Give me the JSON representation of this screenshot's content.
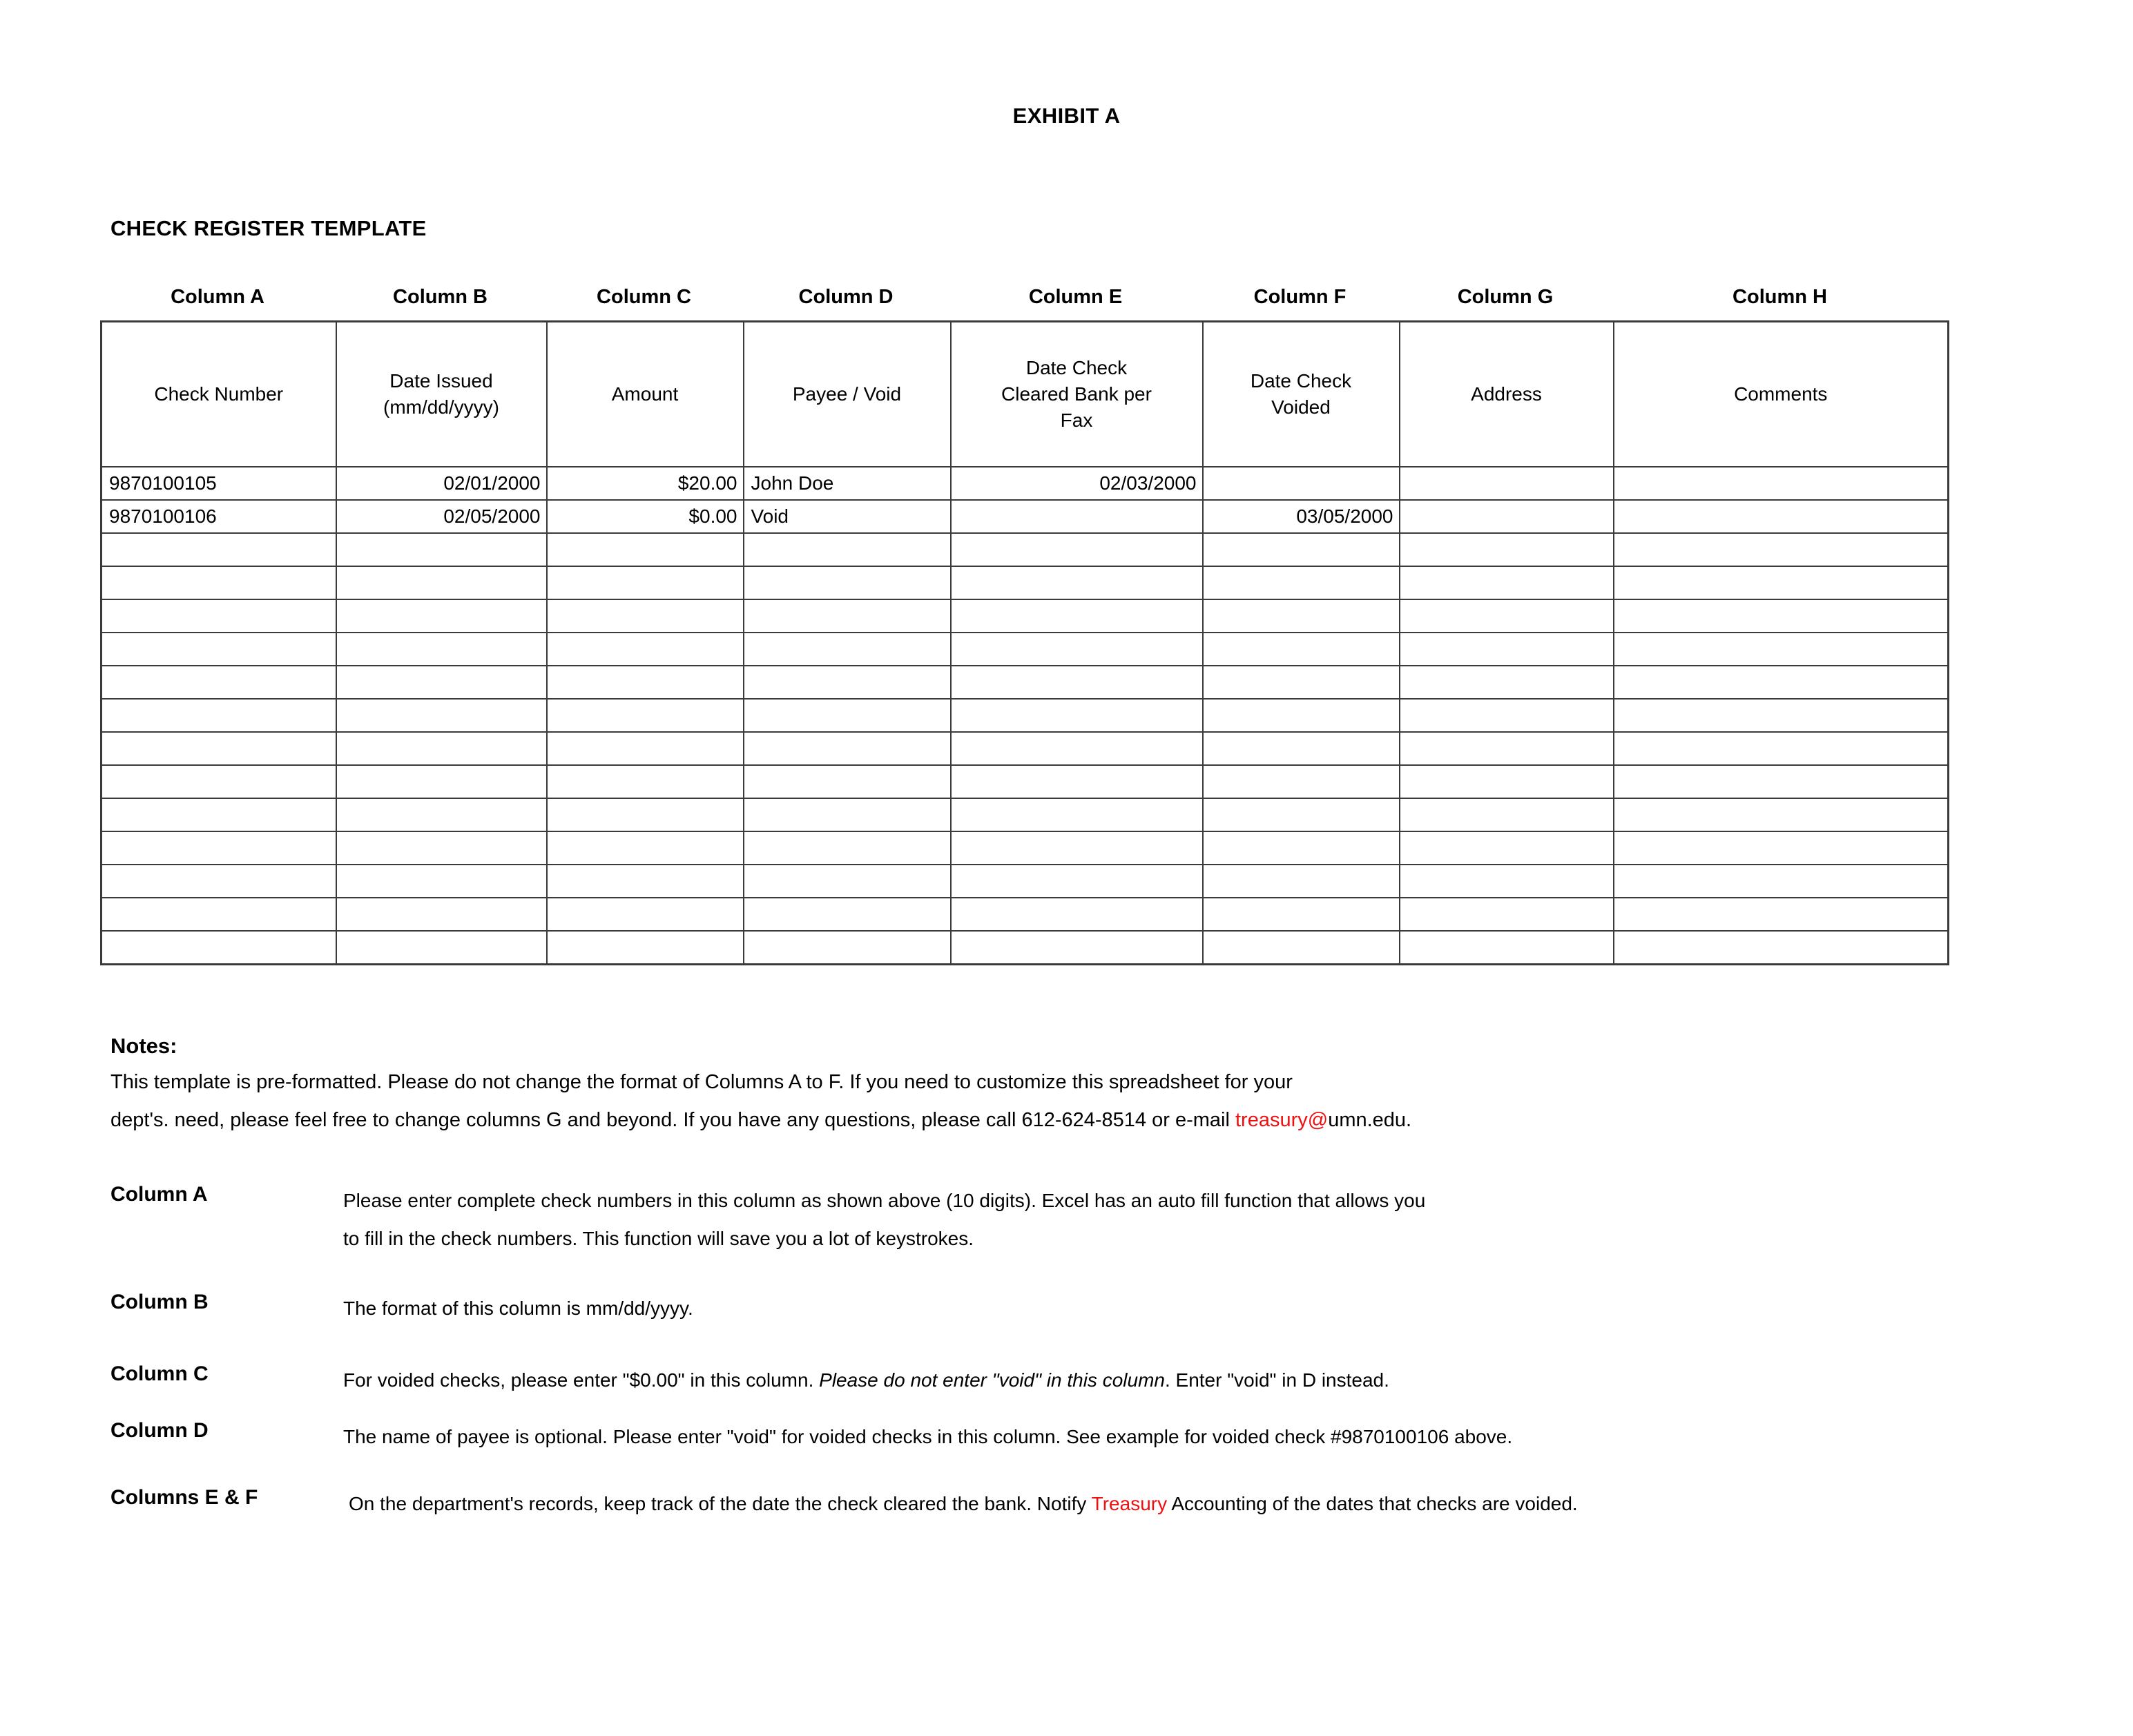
{
  "document": {
    "exhibit_title": "EXHIBIT A",
    "heading": "CHECK REGISTER TEMPLATE"
  },
  "table": {
    "column_letters": [
      "Column A",
      "Column B",
      "Column C",
      "Column D",
      "Column E",
      "Column F",
      "Column G",
      "Column H"
    ],
    "headers": [
      "Check Number",
      "Date Issued\n(mm/dd/yyyy)",
      "Amount",
      "Payee / Void",
      "Date Check\nCleared Bank per\nFax",
      "Date Check\nVoided",
      "Address",
      "Comments"
    ],
    "header_lines": {
      "a": [
        "Check Number"
      ],
      "b": [
        "Date Issued",
        "(mm/dd/yyyy)"
      ],
      "c": [
        "Amount"
      ],
      "d": [
        "Payee / Void"
      ],
      "e": [
        "Date Check",
        "Cleared Bank per",
        "Fax"
      ],
      "f": [
        "Date Check",
        "Voided"
      ],
      "g": [
        "Address"
      ],
      "h": [
        "Comments"
      ]
    },
    "rows": [
      {
        "check_number": "9870100105",
        "date_issued": "02/01/2000",
        "amount": "$20.00",
        "payee": "John Doe",
        "date_cleared": "02/03/2000",
        "date_voided": "",
        "address": "",
        "comments": ""
      },
      {
        "check_number": "9870100106",
        "date_issued": "02/05/2000",
        "amount": "$0.00",
        "payee": "Void",
        "date_cleared": "",
        "date_voided": "03/05/2000",
        "address": "",
        "comments": ""
      }
    ],
    "blank_row_count": 13
  },
  "notes": {
    "title": "Notes:",
    "line1": "This template is pre-formatted.  Please do not change the format of Columns A to F.  If you need to customize this spreadsheet for your",
    "line2_part1": "dept's. need, please feel free to change columns G and beyond.  If you have any questions, please call 612-624-8514 or e-mail ",
    "line2_email_red": "treasury@",
    "line2_email_black": "umn.edu."
  },
  "descriptions": [
    {
      "label": "Column A",
      "lines": [
        "Please enter complete check numbers in this column as shown above (10 digits).  Excel has an auto fill function that allows you",
        "to fill in the check numbers.  This function will save you a lot of keystrokes."
      ]
    },
    {
      "label": "Column B",
      "lines": [
        "The format of this column is mm/dd/yyyy."
      ]
    },
    {
      "label": "Column C",
      "segments": [
        {
          "text": "For voided checks, please enter \"$0.00\" in this column.  ",
          "style": "normal"
        },
        {
          "text": "Please do not enter \"void\" in this column",
          "style": "italic"
        },
        {
          "text": ".  Enter \"void\" in D instead.",
          "style": "normal"
        }
      ]
    },
    {
      "label": "Column D",
      "lines": [
        "The name of payee is optional.  Please enter \"void\" for voided checks in this column.  See example for voided check #9870100106 above."
      ]
    },
    {
      "label": "Columns E & F",
      "segments": [
        {
          "text": "On the department's records, keep track of the date the check cleared the bank.  Notify ",
          "style": "normal"
        },
        {
          "text": "Treasury",
          "style": "red"
        },
        {
          "text": " Accounting of the dates that checks are voided.",
          "style": "normal"
        }
      ]
    }
  ],
  "colors": {
    "accent_red": "#ee1111",
    "grid": "#3a3a3a",
    "text": "#000000"
  }
}
